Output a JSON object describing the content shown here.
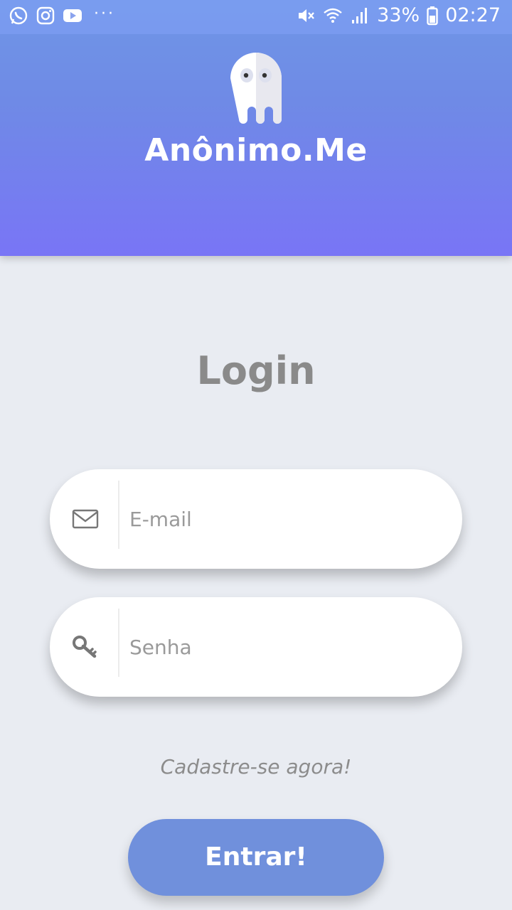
{
  "status_bar": {
    "battery": "33%",
    "time": "02:27",
    "overflow": "···",
    "left_icons": [
      "whatsapp-icon",
      "instagram-icon",
      "youtube-icon"
    ],
    "right_icons": [
      "mute-icon",
      "wifi-icon",
      "signal-icon",
      "battery-icon"
    ]
  },
  "header": {
    "app_title": "Anônimo.Me",
    "gradient_top": "#6f96e6",
    "gradient_bottom": "#7975f6",
    "logo_icon": "ghost-icon"
  },
  "login": {
    "title": "Login",
    "email": {
      "placeholder": "E-mail",
      "value": "",
      "icon": "envelope-icon"
    },
    "password": {
      "placeholder": "Senha",
      "value": "",
      "icon": "key-icon"
    },
    "register_link": "Cadastre-se agora!",
    "submit_label": "Entrar!",
    "button_color": "#7090dc",
    "background": "#e9ecf2"
  }
}
